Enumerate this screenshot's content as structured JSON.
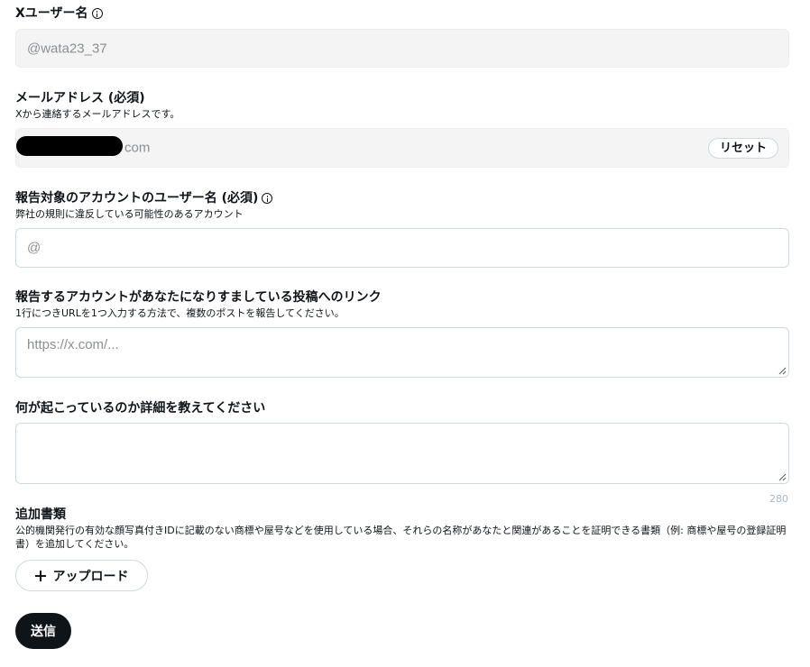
{
  "username": {
    "label": "Xユーザー名",
    "value": "@wata23_37"
  },
  "email": {
    "label": "メールアドレス (必須)",
    "help": "Xから連絡するメールアドレスです。",
    "value_suffix": "com",
    "reset_label": "リセット"
  },
  "reported_account": {
    "label": "報告対象のアカウントのユーザー名 (必須)",
    "help": "弊社の規則に違反している可能性のあるアカウント",
    "placeholder": "@"
  },
  "impersonating_posts": {
    "label": "報告するアカウントがあなたになりすましている投稿へのリンク",
    "help": "1行につきURLを1つ入力する方法で、複数のポストを報告してください。",
    "placeholder": "https://x.com/..."
  },
  "details": {
    "label": "何が起こっているのか詳細を教えてください",
    "char_remaining": "280"
  },
  "additional_documents": {
    "label": "追加書類",
    "help": "公的機関発行の有効な顔写真付きIDに記載のない商標や屋号などを使用している場合、それらの名称があなたと関連があることを証明できる書類（例: 商標や屋号の登録証明書）を追加してください。",
    "upload_label": "アップロード"
  },
  "submit_label": "送信",
  "icons": {
    "info": "info-icon",
    "plus": "plus-icon",
    "resize": "resize-grip-icon"
  }
}
